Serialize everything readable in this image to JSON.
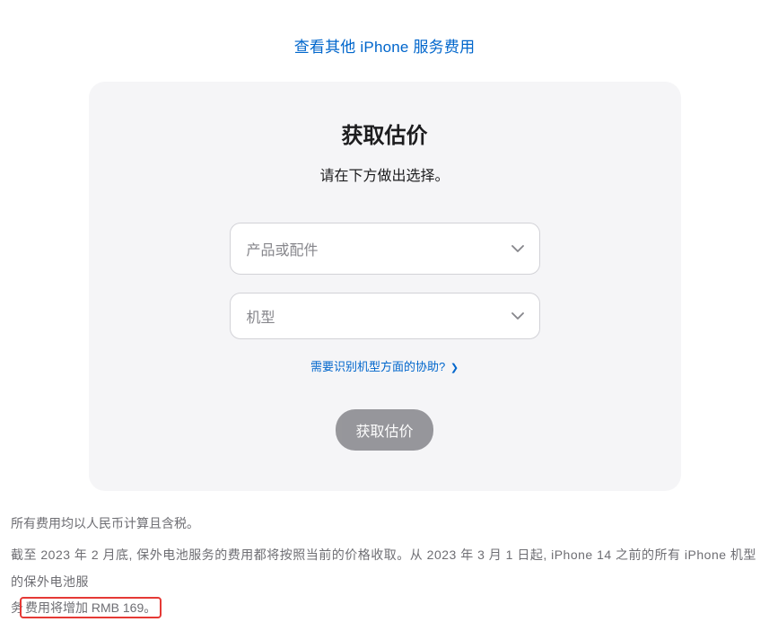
{
  "topLink": "查看其他 iPhone 服务费用",
  "card": {
    "title": "获取估价",
    "subtitle": "请在下方做出选择。",
    "select1Placeholder": "产品或配件",
    "select2Placeholder": "机型",
    "helpLink": "需要识别机型方面的协助?",
    "submitLabel": "获取估价"
  },
  "footer": {
    "line1": "所有费用均以人民币计算且含税。",
    "line2a": "截至 2023 年 2 月底, 保外电池服务的费用都将按照当前的价格收取。从 2023 年 3 月 1 日起, iPhone 14 之前的所有 iPhone 机型的保外电池服",
    "line2b": "务",
    "line2c": "费用将增加 RMB 169。"
  }
}
